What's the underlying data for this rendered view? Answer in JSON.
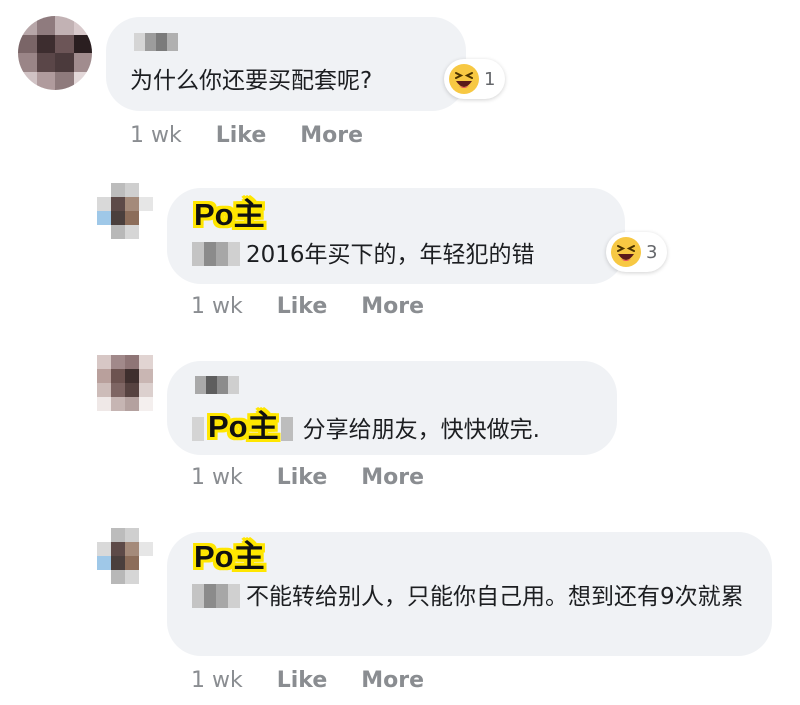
{
  "comments": [
    {
      "author_tag": "",
      "text": "为什么你还要买配套呢?",
      "reaction": {
        "icon": "laughing-emoji-icon",
        "count": "1"
      },
      "meta": {
        "time": "1 wk",
        "like": "Like",
        "more": "More"
      }
    },
    {
      "author_tag": "Po主",
      "text": "2016年买下的，年轻犯的错",
      "reaction": {
        "icon": "laughing-emoji-icon",
        "count": "3"
      },
      "meta": {
        "time": "1 wk",
        "like": "Like",
        "more": "More"
      }
    },
    {
      "author_tag": "Po主",
      "text": "分享给朋友，快快做完.",
      "meta": {
        "time": "1 wk",
        "like": "Like",
        "more": "More"
      }
    },
    {
      "author_tag": "Po主",
      "text": "不能转给别人，只能你自己用。想到还有9次就累",
      "meta": {
        "time": "1 wk",
        "like": "Like",
        "more": "More"
      }
    }
  ],
  "colors": {
    "bubble": "#f0f2f5",
    "meta": "#8a8d91",
    "badge_outline": "#ffe600"
  }
}
